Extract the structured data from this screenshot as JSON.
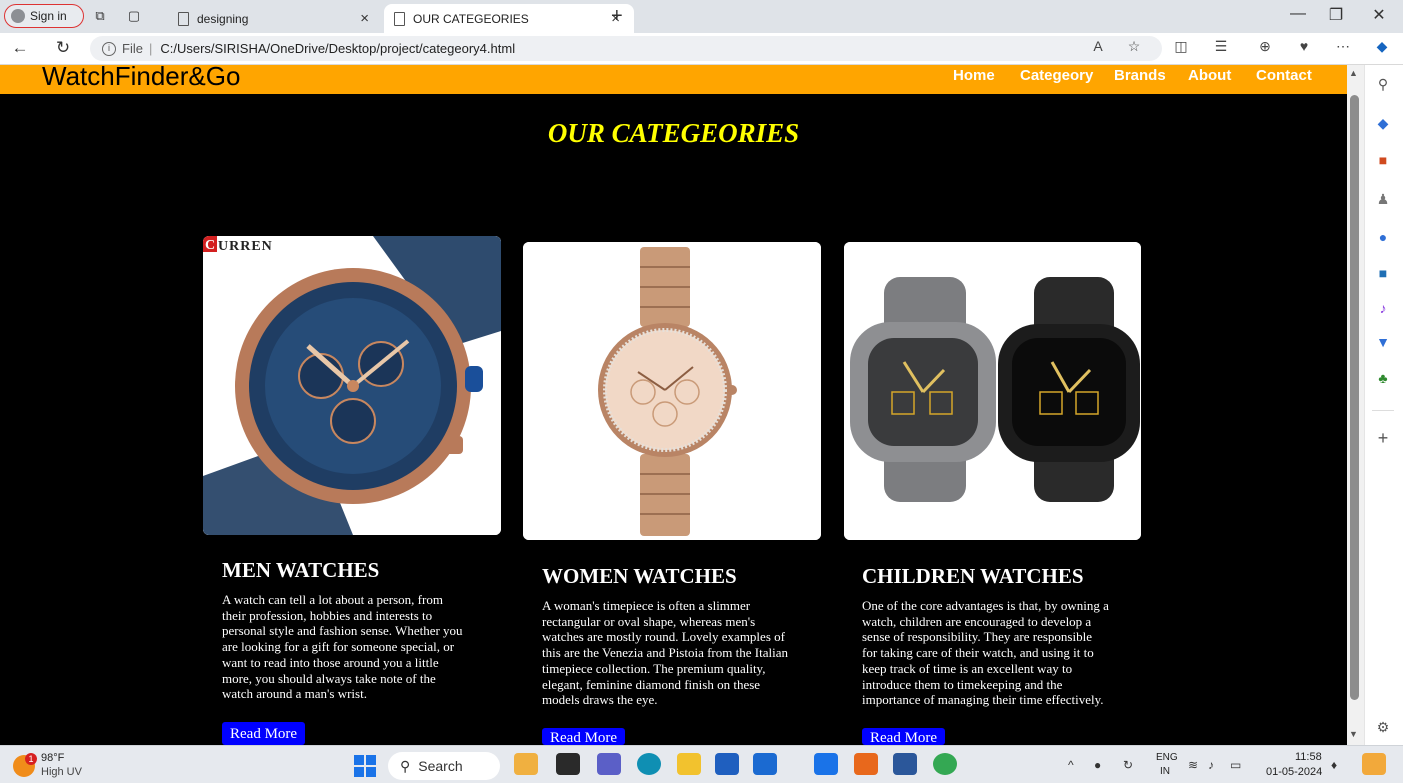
{
  "browser": {
    "signin_label": "Sign in",
    "tabs": [
      {
        "title": "designing",
        "active": false
      },
      {
        "title": "OUR CATEGEORIES",
        "active": true
      }
    ],
    "address": {
      "label": "File",
      "url": "C:/Users/SIRISHA/OneDrive/Desktop/project/categeory4.html"
    }
  },
  "site": {
    "brand": "WatchFinder&Go",
    "header_color": "#ffa500",
    "nav": [
      "Home",
      "Categeory",
      "Brands",
      "About",
      "Contact"
    ],
    "heading": "OUR CATEGEORIES",
    "heading_color": "#ffff00",
    "cards": [
      {
        "title": "MEN WATCHES",
        "image_logo": "URREN",
        "image_logo_initial": "C",
        "desc_lines": [
          "A watch can tell a lot about a person, from",
          "their profession, hobbies and interests to",
          "personal style and fashion sense. Whether you",
          "are looking for a gift for someone special, or",
          "want to read into those around you a little",
          "more, you should always take note of the",
          "watch around a man's wrist."
        ],
        "button": "Read More"
      },
      {
        "title": "WOMEN WATCHES",
        "desc_lines": [
          "A woman's timepiece is often a slimmer",
          "rectangular or oval shape, whereas men's",
          "watches are mostly round. Lovely examples of",
          "this are the Venezia and Pistoia from the Italian",
          "timepiece collection. The premium quality,",
          "elegant, feminine diamond finish on these",
          "models draws the eye."
        ],
        "button": "Read More"
      },
      {
        "title": "CHILDREN WATCHES",
        "desc_lines": [
          "One of the core advantages is that, by owning a",
          "watch, children are encouraged to develop a",
          "sense of responsibility. They are responsible",
          "for taking care of their watch, and using it to",
          "keep track of time is an excellent way to",
          "introduce them to timekeeping and the",
          "importance of managing their time effectively."
        ],
        "button": "Read More"
      }
    ]
  },
  "taskbar": {
    "weather_temp": "98°F",
    "weather_desc": "High UV",
    "weather_badge": "1",
    "search_label": "Search",
    "lang_top": "ENG",
    "lang_bottom": "IN",
    "time": "11:58",
    "date": "01-05-2024"
  }
}
